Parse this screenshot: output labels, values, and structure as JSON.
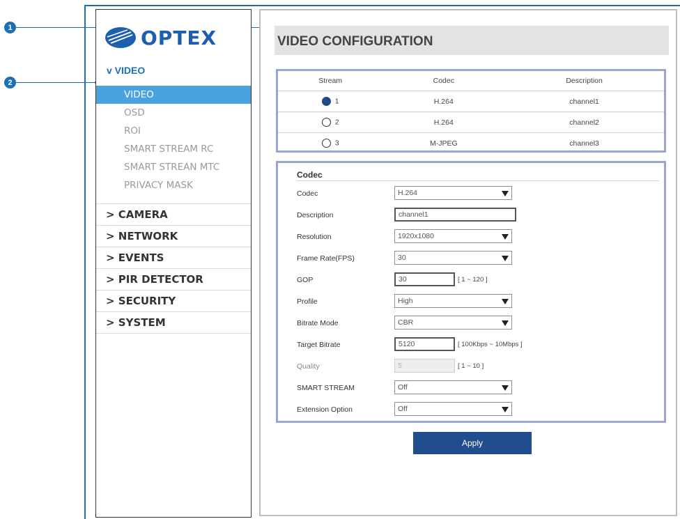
{
  "callouts": [
    "1",
    "2"
  ],
  "brand": {
    "name": "OPTEX"
  },
  "sidebar": {
    "section": "v VIDEO",
    "subitems": [
      "VIDEO",
      "OSD",
      "ROI",
      "SMART STREAM RC",
      "SMART STREAN MTC",
      "PRIVACY MASK"
    ],
    "active_subitem": "VIDEO",
    "nav": [
      "> CAMERA",
      "> NETWORK",
      "> EVENTS",
      "> PIR DETECTOR",
      "> SECURITY",
      "> SYSTEM"
    ]
  },
  "main": {
    "title": "VIDEO CONFIGURATION",
    "stream_table": {
      "headers": [
        "Stream",
        "Codec",
        "Description"
      ],
      "rows": [
        {
          "stream": "1",
          "codec": "H.264",
          "description": "channel1",
          "selected": true
        },
        {
          "stream": "2",
          "codec": "H.264",
          "description": "channel2",
          "selected": false
        },
        {
          "stream": "3",
          "codec": "M-JPEG",
          "description": "channel3",
          "selected": false
        }
      ]
    },
    "codec_section": {
      "heading": "Codec",
      "fields": {
        "codec": {
          "label": "Codec",
          "value": "H.264"
        },
        "description": {
          "label": "Description",
          "value": "channel1"
        },
        "resolution": {
          "label": "Resolution",
          "value": "1920x1080"
        },
        "frame_rate": {
          "label": "Frame Rate(FPS)",
          "value": "30"
        },
        "gop": {
          "label": "GOP",
          "value": "30",
          "range": "[ 1 ~ 120 ]"
        },
        "profile": {
          "label": "Profile",
          "value": "High"
        },
        "bitrate_mode": {
          "label": "Bitrate Mode",
          "value": "CBR"
        },
        "target_bitrate": {
          "label": "Target Bitrate",
          "value": "5120",
          "range": "[ 100Kbps ~ 10Mbps ]"
        },
        "quality": {
          "label": "Quality",
          "value": "5",
          "range": "[ 1 ~ 10 ]"
        },
        "smart_stream": {
          "label": "SMART STREAM",
          "value": "Off"
        },
        "extension_option": {
          "label": "Extension Option",
          "value": "Off"
        }
      }
    },
    "apply_label": "Apply"
  },
  "colors": {
    "accent": "#1b6fb5",
    "active_item": "#4aa3df",
    "apply_button": "#1f4d8e",
    "box_border": "#9aa6cf"
  }
}
